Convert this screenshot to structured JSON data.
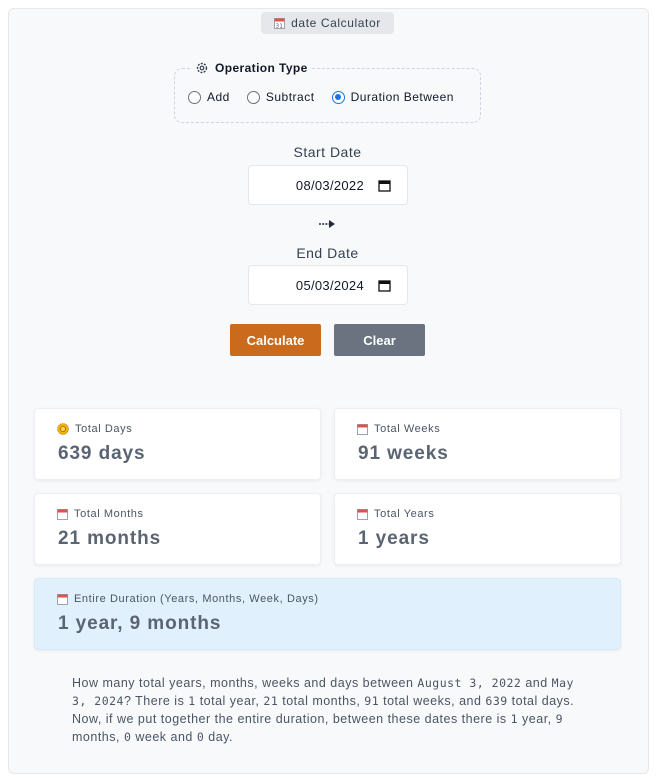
{
  "app": {
    "title": "date Calculator",
    "icon": "calendar-icon"
  },
  "operation": {
    "legend": "Operation Type",
    "legend_icon": "gear-icon",
    "options": [
      {
        "label": "Add",
        "checked": false
      },
      {
        "label": "Subtract",
        "checked": false
      },
      {
        "label": "Duration Between",
        "checked": true
      }
    ]
  },
  "start": {
    "label": "Start Date",
    "value": "08/03/2022"
  },
  "end": {
    "label": "End Date",
    "value": "05/03/2024"
  },
  "buttons": {
    "calculate": "Calculate",
    "clear": "Clear"
  },
  "results": {
    "total_days": {
      "label": "Total Days",
      "value": "639 days",
      "icon": "sun-icon"
    },
    "total_weeks": {
      "label": "Total Weeks",
      "value": "91 weeks",
      "icon": "calendar-icon"
    },
    "total_months": {
      "label": "Total Months",
      "value": "21 months",
      "icon": "calendar-icon"
    },
    "total_years": {
      "label": "Total Years",
      "value": "1 years",
      "icon": "calendar-icon"
    },
    "entire": {
      "label": "Entire Duration (Years, Months, Week, Days)",
      "value": "1 year, 9 months",
      "icon": "calendar-icon"
    }
  },
  "description": {
    "p1": "How many total years, months, weeks and days between ",
    "d1": "August 3, 2022",
    "p2": " and ",
    "d2": "May 3, 2024",
    "p3": "? There is ",
    "n1": "1",
    "p4": " total year, ",
    "n2": "21",
    "p5": " total months, ",
    "n3": "91",
    "p6": " total weeks, and ",
    "n4": "639",
    "p7": " total days. Now, if we put together the entire duration, between these dates there is ",
    "n5": "1",
    "p8": " year, ",
    "n6": "9",
    "p9": " months, ",
    "n7": "0",
    "p10": " week and ",
    "n8": "0",
    "p11": " day."
  },
  "colors": {
    "accent": "#c96a1c",
    "secondary": "#6b7280",
    "radio": "#1a73e8",
    "highlight": "#e0f0fd"
  }
}
